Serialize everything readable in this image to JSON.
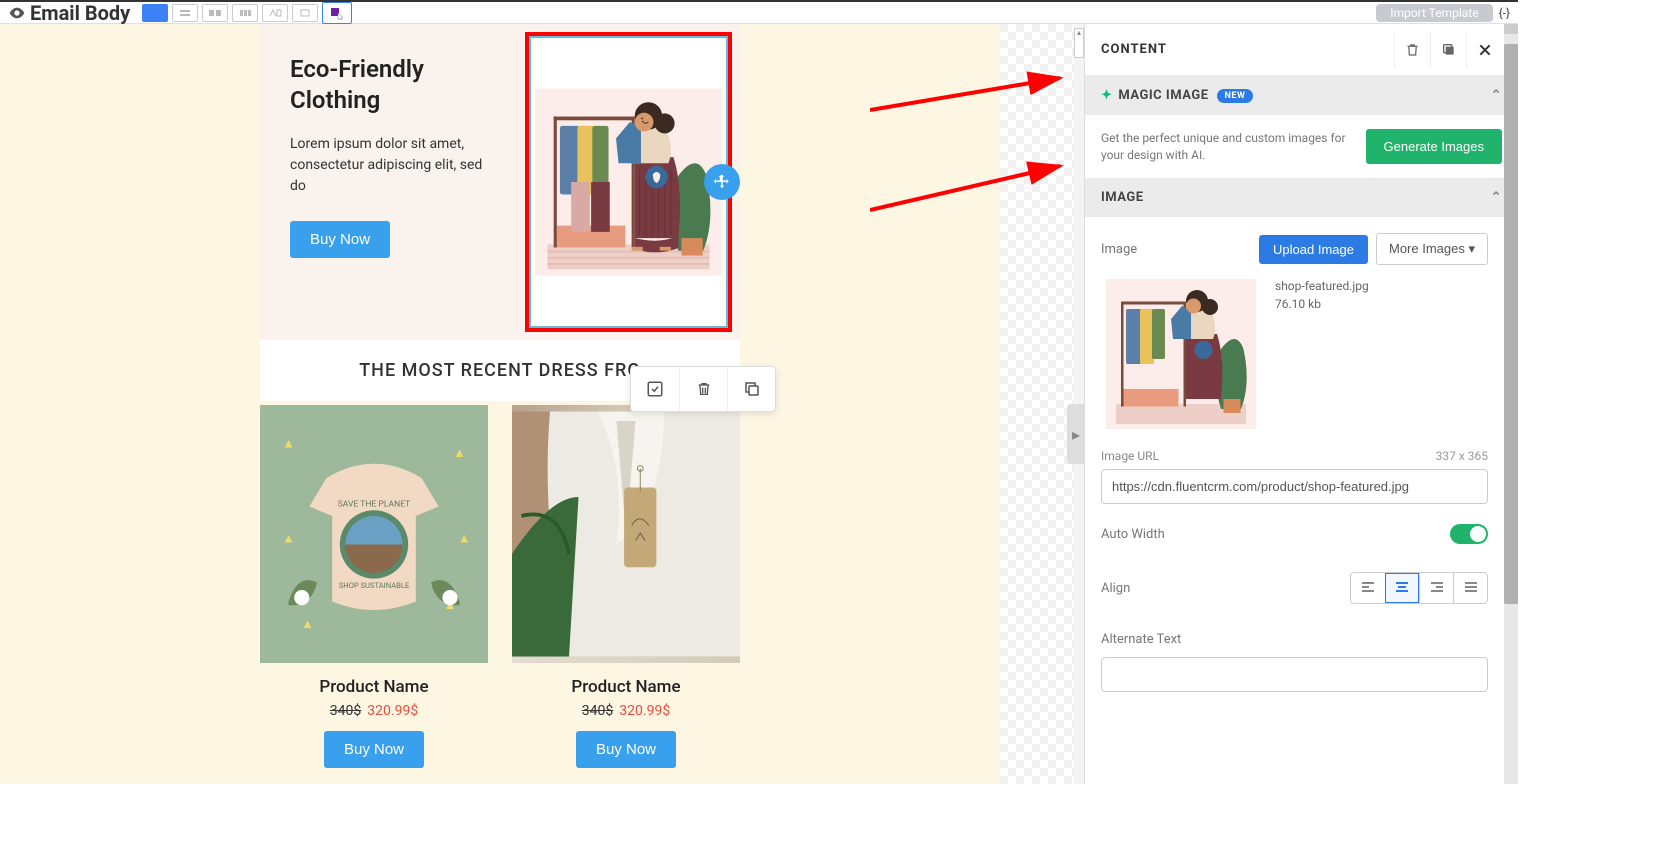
{
  "topbar": {
    "title": "Email Body",
    "import_label": "Import Template",
    "code_symbol": "{-}"
  },
  "hero": {
    "heading": "Eco-Friendly Clothing",
    "body": "Lorem ipsum dolor sit amet, consectetur adipiscing elit, sed do",
    "buy_label": "Buy Now"
  },
  "section_title": "THE MOST RECENT DRESS FRO",
  "products": [
    {
      "name": "Product Name",
      "old_price": "340$",
      "new_price": "320.99$",
      "buy_label": "Buy Now",
      "tshirt_top": "SAVE THE PLANET",
      "tshirt_bottom": "SHOP SUSTAINABLE"
    },
    {
      "name": "Product Name",
      "old_price": "340$",
      "new_price": "320.99$",
      "buy_label": "Buy Now"
    }
  ],
  "sidebar": {
    "content_title": "CONTENT",
    "magic": {
      "title": "MAGIC IMAGE",
      "pill": "NEW",
      "desc": "Get the perfect unique and custom images for your design with AI.",
      "button": "Generate Images"
    },
    "image_section": {
      "title": "IMAGE",
      "label_image": "Image",
      "upload": "Upload Image",
      "more": "More Images",
      "filename": "shop-featured.jpg",
      "filesize": "76.10 kb",
      "url_label": "Image URL",
      "dimensions": "337 x 365",
      "url_value": "https://cdn.fluentcrm.com/product/shop-featured.jpg",
      "auto_width": "Auto Width",
      "align": "Align",
      "alt": "Alternate Text"
    }
  }
}
